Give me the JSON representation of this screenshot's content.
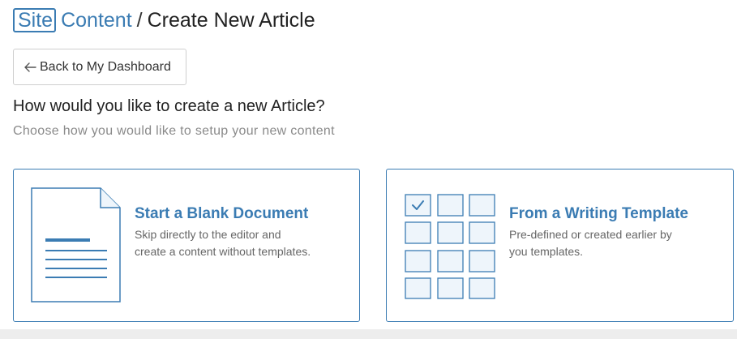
{
  "header": {
    "brand_part1": "Site",
    "brand_part2": "Content",
    "separator": "/",
    "page_title": "Create New Article"
  },
  "back_button": {
    "label": "Back to My Dashboard",
    "icon": "arrow-left-icon"
  },
  "prompt": {
    "question": "How would you like to create a new Article?",
    "subtitle": "Choose how you would like to setup your new content"
  },
  "options": [
    {
      "title": "Start a Blank Document",
      "desc_line1": "Skip directly to the editor and",
      "desc_line2": "create a content without templates.",
      "icon": "document-icon"
    },
    {
      "title": "From a Writing Template",
      "desc_line1": "Pre-defined or created earlier by",
      "desc_line2": "you templates.",
      "icon": "template-grid-icon"
    }
  ],
  "colors": {
    "accent": "#3b7cb3",
    "tile_fill": "#eef5fb"
  }
}
